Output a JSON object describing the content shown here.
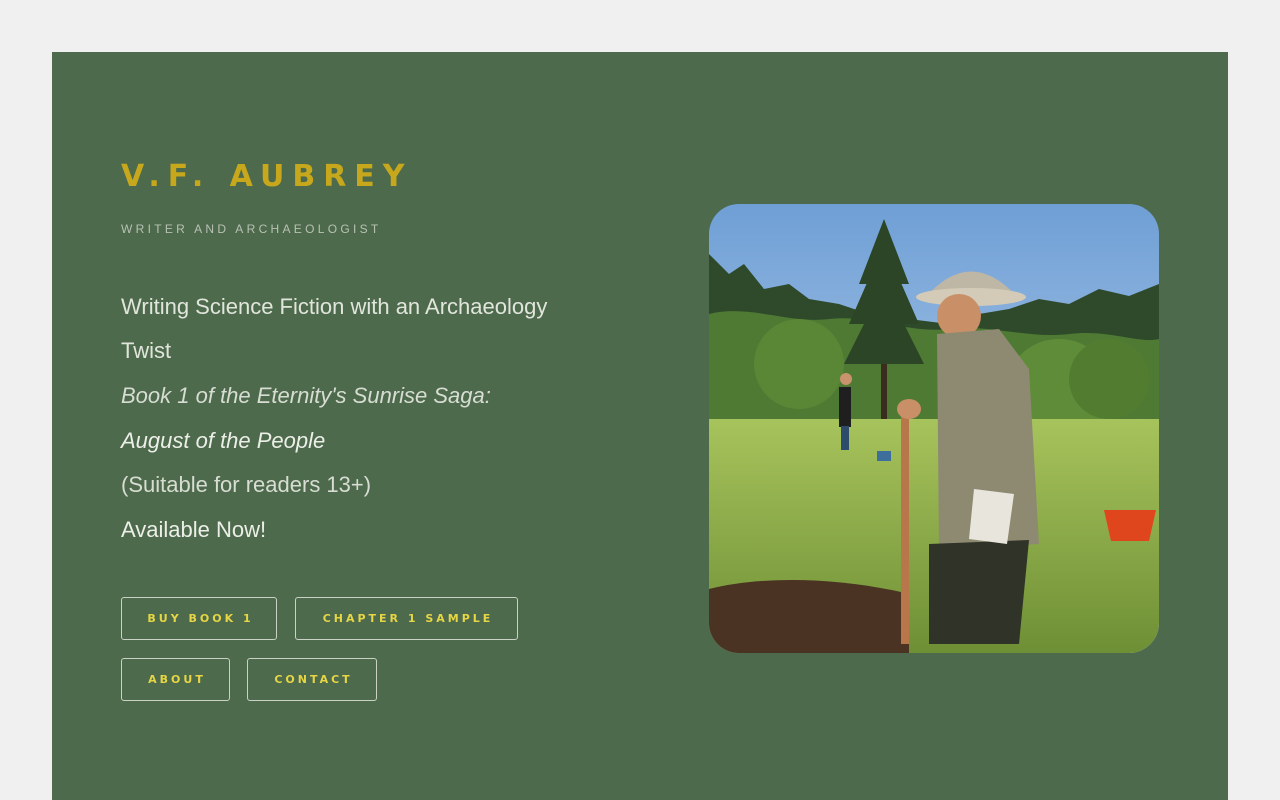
{
  "author": {
    "name": "V.F. AUBREY",
    "tagline": "WRITER AND ARCHAEOLOGIST"
  },
  "intro": {
    "line1": "Writing Science Fiction with an Archaeology",
    "line2": "Twist",
    "series_line": "Book 1 of the Eternity's Sunrise Saga:",
    "book_title": "August of the People",
    "age_note": "(Suitable for readers 13+)",
    "availability": "Available Now!"
  },
  "buttons": {
    "buy": "BUY BOOK 1",
    "sample": "CHAPTER 1 SAMPLE",
    "about": "ABOUT",
    "contact": "CONTACT"
  },
  "colors": {
    "page_background": "#f0f0f0",
    "panel_green": "#4e6a4c",
    "name_gold": "#c7a81c",
    "button_text_yellow": "#e6d645"
  }
}
